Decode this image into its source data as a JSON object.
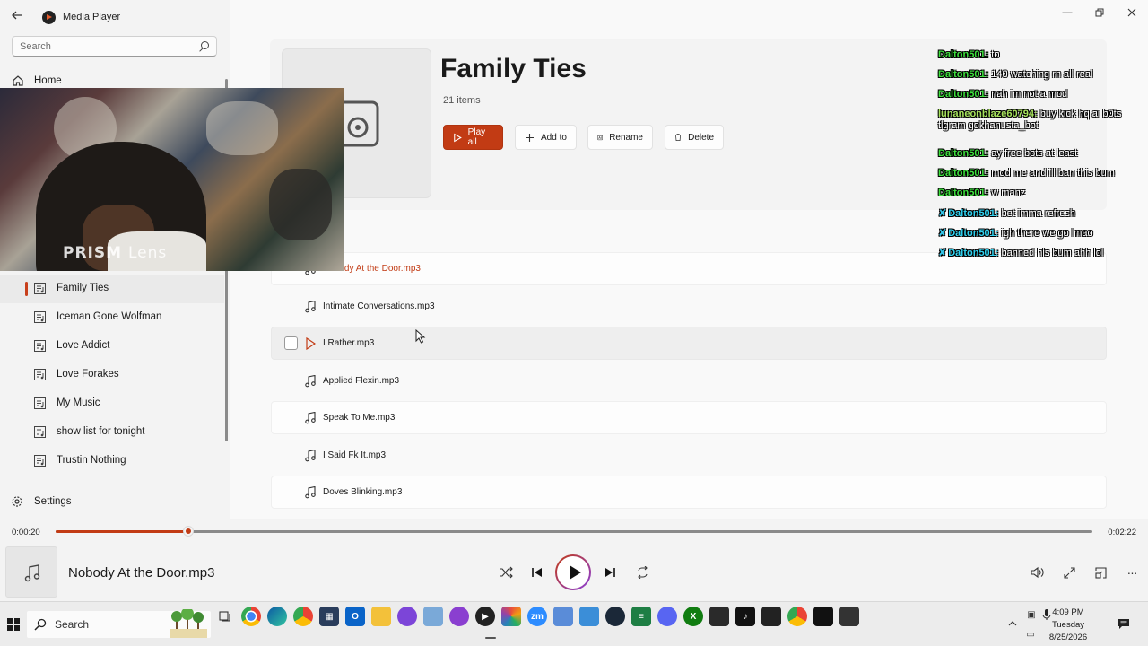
{
  "app": {
    "title": "Media Player"
  },
  "sidebar": {
    "search_placeholder": "Search",
    "home_label": "Home",
    "playlists": [
      {
        "label": "Family Ties",
        "active": true
      },
      {
        "label": "Iceman Gone Wolfman"
      },
      {
        "label": "Love Addict"
      },
      {
        "label": "Love Forakes"
      },
      {
        "label": "My Music"
      },
      {
        "label": "show list  for tonight"
      },
      {
        "label": "Trustin Nothing"
      }
    ],
    "settings_label": "Settings"
  },
  "playlist": {
    "title": "Family Ties",
    "count": "21 items",
    "buttons": {
      "play_all": "Play all",
      "add_to": "Add to",
      "rename": "Rename",
      "delete": "Delete"
    },
    "songs": [
      {
        "title": "Nobody At the Door.mp3",
        "playing": true
      },
      {
        "title": "Intimate Conversations.mp3"
      },
      {
        "title": "I Rather.mp3",
        "hover": true
      },
      {
        "title": "Applied Flexin.mp3"
      },
      {
        "title": "Speak To Me.mp3"
      },
      {
        "title": "I Said Fk It.mp3"
      },
      {
        "title": "Doves Blinking.mp3"
      }
    ]
  },
  "webcam": {
    "label_bold": "PRISM",
    "label_light": "Lens"
  },
  "chat": [
    {
      "user": "Dalton501:",
      "text": " to",
      "color": "green"
    },
    {
      "user": "Dalton501:",
      "text": " 140 watching rn all real",
      "color": "green"
    },
    {
      "user": "Dalton501:",
      "text": " nah im not a mod",
      "color": "green"
    },
    {
      "user": "lunaneonblaze60794:",
      "text": " buy kick hq ai b0ts",
      "text2": "tlgram gokhanusta_bot",
      "color": "lime"
    },
    {
      "user": "Dalton501:",
      "text": " ay free bots at least",
      "color": "green"
    },
    {
      "user": "Dalton501:",
      "text": " mod me and ill ban this bum",
      "color": "green"
    },
    {
      "user": "Dalton501:",
      "text": " w manz",
      "color": "green"
    },
    {
      "user": "Dalton501:",
      "text": " bet imma refresh",
      "color": "blue",
      "badge": true
    },
    {
      "user": "Dalton501:",
      "text": " igh there we go lmao",
      "color": "blue",
      "badge": true
    },
    {
      "user": "Dalton501:",
      "text": " banned his bum ahh lol",
      "color": "blue",
      "badge": true
    }
  ],
  "player": {
    "current_time": "0:00:20",
    "total_time": "0:02:22",
    "progress": 0.128,
    "now_playing": "Nobody At the Door.mp3",
    "accent": "#c23b14"
  },
  "taskbar": {
    "search_label": "Search",
    "time": "4:09 PM",
    "day": "Tuesday",
    "date": "8/25/2026"
  }
}
